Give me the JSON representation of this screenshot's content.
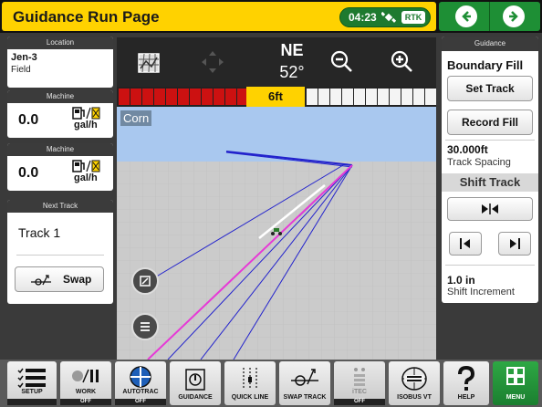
{
  "header": {
    "title": "Guidance Run Page",
    "time": "04:23",
    "rtk_label": "RTK",
    "back_icon": "back-arrow-icon",
    "forward_icon": "forward-arrow-icon"
  },
  "left_panel": {
    "location": {
      "header": "Location",
      "name": "Jen-3",
      "type": "Field"
    },
    "machine_1": {
      "header": "Machine",
      "value": "0.0",
      "unit": "gal/h",
      "icon": "fuel-rate-icon"
    },
    "machine_2": {
      "header": "Machine",
      "value": "0.0",
      "unit": "gal/h",
      "icon": "fuel-rate-icon"
    },
    "next_track": {
      "header": "Next Track",
      "track": "Track 1",
      "swap_label": "Swap"
    }
  },
  "map": {
    "heading_dir": "NE",
    "heading_deg": "52°",
    "lightbar_label": "6ft",
    "crop_label": "Corn",
    "colors": {
      "sky": "#a9c8ef",
      "ground": "#c9c9c9",
      "pass_line": "#e63ad6",
      "guide_line": "#2222cc",
      "lightbar_red": "#cc1111"
    }
  },
  "right_panel": {
    "header": "Guidance",
    "mode": "Boundary Fill",
    "set_track": "Set Track",
    "record_fill": "Record Fill",
    "track_spacing_value": "30.000ft",
    "track_spacing_label": "Track Spacing",
    "shift_track": "Shift Track",
    "shift_increment_value": "1.0 in",
    "shift_increment_label": "Shift Increment"
  },
  "dock": [
    {
      "label": "SETUP",
      "status": "",
      "icon": "setup-list-icon"
    },
    {
      "label": "WORK",
      "status": "OFF",
      "icon": "work-record-icon"
    },
    {
      "label": "AUTOTRAC",
      "status": "OFF",
      "icon": "autotrac-steering-icon"
    },
    {
      "label": "GUIDANCE",
      "status": "",
      "icon": "guidance-icon"
    },
    {
      "label": "QUICK LINE",
      "status": "",
      "icon": "quick-line-icon"
    },
    {
      "label": "SWAP TRACK",
      "status": "",
      "icon": "swap-track-icon"
    },
    {
      "label": "iTEC",
      "status": "OFF",
      "icon": "itec-icon"
    },
    {
      "label": "ISOBUS VT",
      "status": "",
      "icon": "isobus-vt-icon"
    },
    {
      "label": "HELP",
      "status": "",
      "icon": "help-icon"
    },
    {
      "label": "MENU",
      "status": "",
      "icon": "menu-grid-icon"
    }
  ]
}
